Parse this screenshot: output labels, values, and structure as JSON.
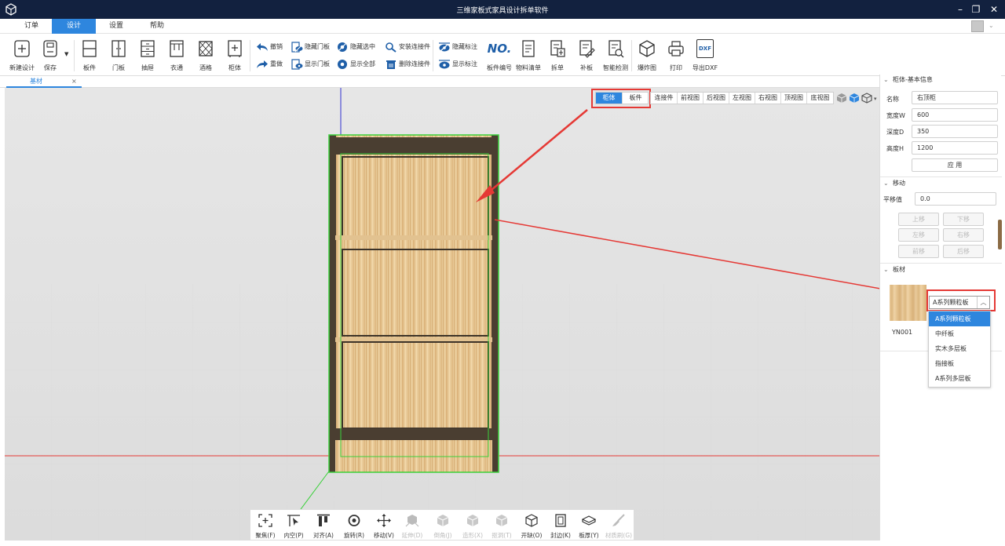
{
  "window": {
    "title": "三维家板式家具设计拆单软件"
  },
  "menu_tabs": [
    "订单",
    "设计",
    "设置",
    "帮助"
  ],
  "toolbar": {
    "big_buttons": [
      {
        "label": "新建设计",
        "icon": "new-design-icon"
      },
      {
        "label": "保存",
        "icon": "save-icon"
      },
      {
        "label": "板件",
        "icon": "board-icon"
      },
      {
        "label": "门板",
        "icon": "door-panel-icon"
      },
      {
        "label": "抽屉",
        "icon": "drawer-icon"
      },
      {
        "label": "衣通",
        "icon": "clothes-rail-icon"
      },
      {
        "label": "酒格",
        "icon": "wine-rack-icon"
      },
      {
        "label": "柜体",
        "icon": "cabinet-icon"
      }
    ],
    "small_buttons": [
      {
        "label": "撤销",
        "icon": "undo-icon"
      },
      {
        "label": "重做",
        "icon": "redo-icon"
      },
      {
        "label": "隐藏门板",
        "icon": "hide-door-icon"
      },
      {
        "label": "显示门板",
        "icon": "show-door-icon"
      },
      {
        "label": "隐藏选中",
        "icon": "hide-selected-icon"
      },
      {
        "label": "显示全部",
        "icon": "show-all-icon"
      },
      {
        "label": "安装连接件",
        "icon": "install-connector-icon"
      },
      {
        "label": "删除连接件",
        "icon": "delete-connector-icon"
      },
      {
        "label": "隐藏标注",
        "icon": "hide-annotation-icon"
      },
      {
        "label": "显示标注",
        "icon": "show-annotation-icon"
      }
    ],
    "right_buttons": [
      {
        "label": "板件编号",
        "icon": "board-number-icon",
        "glyph": "NO."
      },
      {
        "label": "物料清单",
        "icon": "material-list-icon"
      },
      {
        "label": "拆单",
        "icon": "split-order-icon"
      },
      {
        "label": "补板",
        "icon": "add-board-icon"
      },
      {
        "label": "智能检测",
        "icon": "smart-check-icon"
      },
      {
        "label": "爆炸图",
        "icon": "explode-view-icon"
      },
      {
        "label": "打印",
        "icon": "print-icon"
      },
      {
        "label": "导出DXF",
        "icon": "export-dxf-icon",
        "glyph": "DXF"
      }
    ]
  },
  "doc_tab": {
    "label": "基材",
    "close": "×"
  },
  "view_toggle": [
    "柜体",
    "板件"
  ],
  "view_buttons": [
    "连接件",
    "前视图",
    "后视图",
    "左视图",
    "右视图",
    "顶视图",
    "底视图"
  ],
  "bottom_tools": [
    {
      "label": "聚焦(F)",
      "icon": "focus-icon",
      "enabled": true
    },
    {
      "label": "内空(P)",
      "icon": "inner-space-icon",
      "enabled": true
    },
    {
      "label": "对齐(A)",
      "icon": "align-icon",
      "enabled": true
    },
    {
      "label": "旋转(R)",
      "icon": "rotate-icon",
      "enabled": true
    },
    {
      "label": "移动(V)",
      "icon": "move-icon",
      "enabled": true
    },
    {
      "label": "延伸(D)",
      "icon": "extend-icon",
      "enabled": false
    },
    {
      "label": "倒角(J)",
      "icon": "chamfer-icon",
      "enabled": false
    },
    {
      "label": "造形(X)",
      "icon": "shape-icon",
      "enabled": false
    },
    {
      "label": "抠洞(T)",
      "icon": "cut-hole-icon",
      "enabled": false
    },
    {
      "label": "开缺(O)",
      "icon": "notch-icon",
      "enabled": true
    },
    {
      "label": "封边(K)",
      "icon": "edge-band-icon",
      "enabled": true
    },
    {
      "label": "板厚(Y)",
      "icon": "thickness-icon",
      "enabled": true
    },
    {
      "label": "材质刷(G)",
      "icon": "material-brush-icon",
      "enabled": false
    }
  ],
  "panel": {
    "basic": {
      "header": "柜体-基本信息",
      "fields": [
        {
          "label": "名称",
          "value": "右顶柜"
        },
        {
          "label": "宽度W",
          "value": "600"
        },
        {
          "label": "深度D",
          "value": "350"
        },
        {
          "label": "高度H",
          "value": "1200"
        }
      ],
      "apply": "应 用"
    },
    "move": {
      "header": "移动",
      "label": "平移值",
      "value": "0.0",
      "buttons": [
        "上移",
        "下移",
        "左移",
        "右移",
        "前移",
        "后移"
      ]
    },
    "material": {
      "header": "板材",
      "code": "YN001",
      "selected": "A系列颗粒板",
      "options": [
        "A系列颗粒板",
        "中纤板",
        "实木多层板",
        "指接板",
        "A系列多层板"
      ]
    }
  },
  "colors": {
    "accent": "#2e86de",
    "titlebar": "#12213f",
    "highlight": "#e53935"
  }
}
